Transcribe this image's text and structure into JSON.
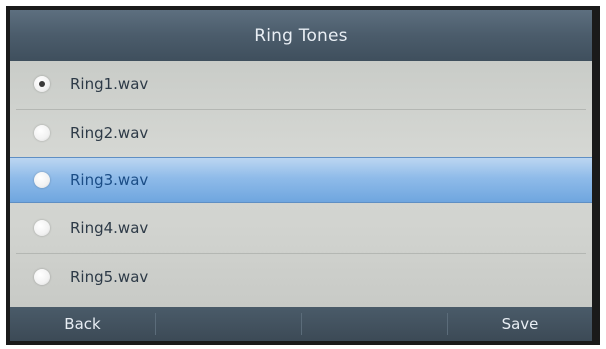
{
  "header": {
    "title": "Ring Tones"
  },
  "ring_tones": {
    "selected_index": 2,
    "checked_index": 0,
    "items": [
      {
        "label": "Ring1.wav"
      },
      {
        "label": "Ring2.wav"
      },
      {
        "label": "Ring3.wav"
      },
      {
        "label": "Ring4.wav"
      },
      {
        "label": "Ring5.wav"
      }
    ]
  },
  "softkeys": {
    "back_label": "Back",
    "key2_label": "",
    "key3_label": "",
    "save_label": "Save"
  },
  "colors": {
    "title_bar": "#4b5c6b",
    "list_background": "#d6d8d4",
    "selection_highlight": "#8fbbe9",
    "softkey_bar": "#3c4a56"
  }
}
